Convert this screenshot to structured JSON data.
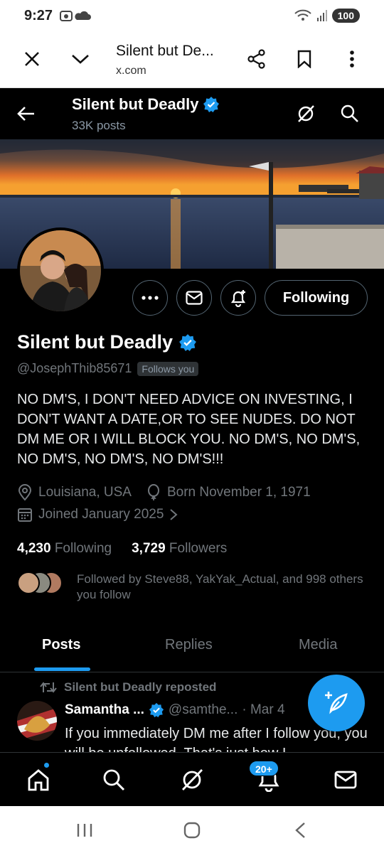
{
  "status_bar": {
    "time": "9:27",
    "battery": "100"
  },
  "browser": {
    "page_title": "Silent but De...",
    "url": "x.com"
  },
  "header": {
    "name": "Silent but Deadly",
    "posts_count": "33K posts"
  },
  "profile": {
    "name": "Silent but Deadly",
    "handle": "@JosephThib85671",
    "follows_you": "Follows you",
    "follow_button": "Following",
    "bio": "NO DM'S, I DON'T NEED ADVICE ON INVESTING, I DON'T WANT A DATE,OR TO SEE NUDES. DO NOT DM ME OR I WILL BLOCK YOU. NO DM'S, NO DM'S, NO DM'S, NO DM'S, NO DM'S!!!",
    "location": "Louisiana, USA",
    "birthday": "Born November 1, 1971",
    "joined": "Joined January 2025",
    "following_count": "4,230",
    "following_label": "Following",
    "followers_count": "3,729",
    "followers_label": "Followers",
    "followed_by": "Followed by Steve88, YakYak_Actual, and 998 others you follow"
  },
  "tabs": [
    {
      "label": "Posts",
      "active": true
    },
    {
      "label": "Replies",
      "active": false
    },
    {
      "label": "Media",
      "active": false
    }
  ],
  "post": {
    "repost_label": "Silent but Deadly reposted",
    "author_name": "Samantha ...",
    "author_handle": "@samthe...",
    "date": "· Mar 4",
    "text": "If you immediately DM me after I follow you, you will be unfollowed. That's just how I"
  },
  "bottom_nav": {
    "notifications_badge": "20+"
  },
  "colors": {
    "accent": "#1d9bf0",
    "background": "#000000",
    "secondary_text": "#71767b"
  }
}
